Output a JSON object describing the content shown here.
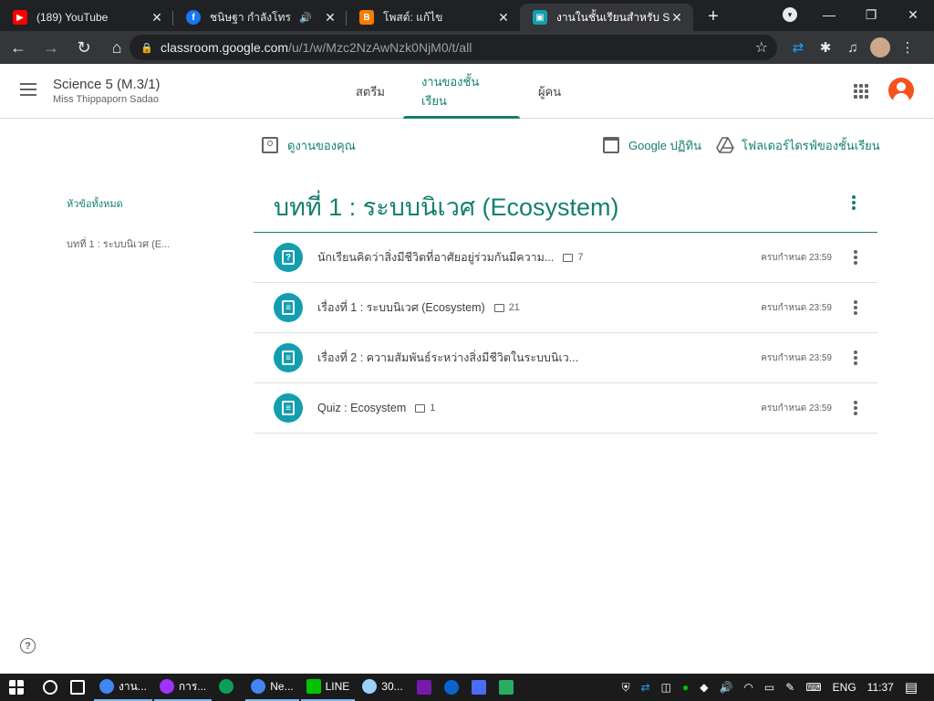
{
  "browser": {
    "tabs": [
      {
        "title": "(189) YouTube",
        "icon": "youtube-icon",
        "color": "#ff0000",
        "letter": "▶"
      },
      {
        "title": "ชนิษฐา กำลังโทร",
        "icon": "facebook-icon",
        "color": "#1877f2",
        "letter": "f",
        "audio": "🔊"
      },
      {
        "title": "โพสต์: แก้ไข",
        "icon": "blogger-icon",
        "color": "#f57d00",
        "letter": "B"
      },
      {
        "title": "งานในชั้นเรียนสำหรับ Scien",
        "icon": "classroom-icon",
        "color": "#129eaf",
        "letter": "▣"
      }
    ],
    "new_tab": "+",
    "url_host": "classroom.google.com",
    "url_path": "/u/1/w/Mzc2NzAwNzk0NjM0/t/all"
  },
  "appbar": {
    "class_title": "Science 5 (M.3/1)",
    "teacher": "Miss Thippaporn Sadao",
    "tabs": [
      "สตรีม",
      "งานของชั้นเรียน",
      "ผู้คน"
    ]
  },
  "actions": {
    "your_work": "ดูงานของคุณ",
    "calendar": "Google ปฏิทิน",
    "drive": "โฟลเดอร์ไดรฟ์ของชั้นเรียน"
  },
  "sidebar": {
    "all_topics": "หัวข้อทั้งหมด",
    "topic1": "บทที่ 1 : ระบบนิเวศ (E..."
  },
  "topic": {
    "title": "บทที่ 1 : ระบบนิเวศ (Ecosystem)"
  },
  "items": [
    {
      "title": "นักเรียนคิดว่าสิ่งมีชีวิตที่อาศัยอยู่ร่วมกันมีความ...",
      "comments": "7",
      "due": "ครบกำหนด 23:59",
      "icon": "question-icon"
    },
    {
      "title": "เรื่องที่ 1 : ระบบนิเวศ (Ecosystem)",
      "comments": "21",
      "due": "ครบกำหนด 23:59",
      "icon": "assignment-icon"
    },
    {
      "title": "เรื่องที่ 2 : ความสัมพันธ์ระหว่างสิ่งมีชีวิตในระบบนิเว...",
      "comments": "",
      "due": "ครบกำหนด 23:59",
      "icon": "assignment-icon"
    },
    {
      "title": "Quiz : Ecosystem",
      "comments": "1",
      "due": "ครบกำหนด 23:59",
      "icon": "assignment-icon"
    }
  ],
  "taskbar": {
    "apps": [
      {
        "label": "งาน...",
        "color": "#4285f4"
      },
      {
        "label": "การ...",
        "color": "#a033ff"
      },
      {
        "label": "",
        "color": "#0f9d58"
      },
      {
        "label": "Ne...",
        "color": "#4285f4"
      },
      {
        "label": "LINE",
        "color": "#00c300"
      },
      {
        "label": "30...",
        "color": "#9bd1ff"
      }
    ],
    "lang": "ENG",
    "time": "11:37"
  }
}
